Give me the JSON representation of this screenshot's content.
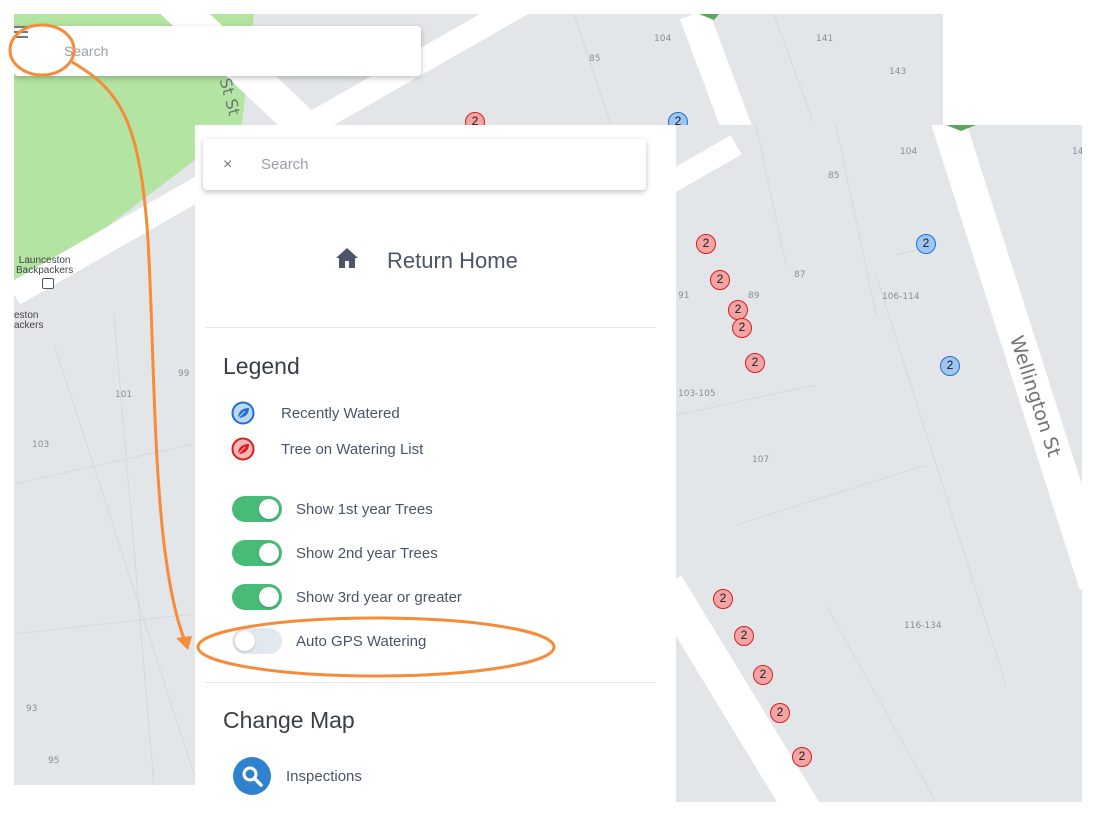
{
  "background_map": {
    "search_placeholder": "Search",
    "street_top": "St St",
    "street_top_right": "St",
    "lot_labels": [
      "104",
      "141",
      "85",
      "143",
      "101",
      "103",
      "99",
      "93",
      "95"
    ],
    "poi_1": "Launceston\nBackpackers",
    "poi_2": "eston\nackers"
  },
  "right_map": {
    "street_name": "Wellington St",
    "lot_labels": [
      "104",
      "85",
      "87",
      "106-114",
      "89",
      "91",
      "103-105",
      "107",
      "116-134",
      "14"
    ],
    "marker_count_label": "2",
    "colors": {
      "red_marker": "#d81e1e",
      "blue_marker": "#1f6fd0"
    }
  },
  "menu": {
    "search_placeholder": "Search",
    "close_label": "×",
    "return_home": "Return Home",
    "legend_title": "Legend",
    "legend_items": [
      {
        "label": "Recently Watered",
        "color": "#3182ce"
      },
      {
        "label": "Tree on Watering List",
        "color": "#e53e3e"
      }
    ],
    "toggles": [
      {
        "label": "Show 1st year Trees",
        "on": true
      },
      {
        "label": "Show 2nd year Trees",
        "on": true
      },
      {
        "label": "Show 3rd year or greater",
        "on": true
      },
      {
        "label": "Auto GPS Watering",
        "on": false
      }
    ],
    "change_map_title": "Change Map",
    "map_items": [
      {
        "label": "Inspections"
      }
    ]
  },
  "annotation": {
    "color": "#f68b3a"
  }
}
